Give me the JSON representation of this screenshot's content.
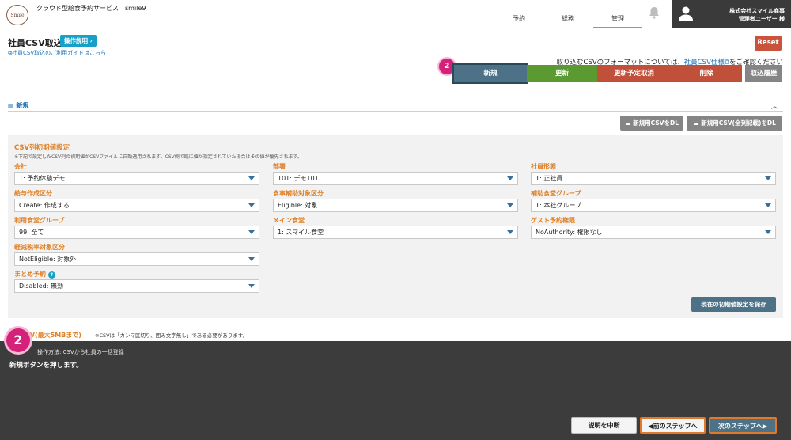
{
  "header": {
    "logo_text": "Smile",
    "service_name": "クラウド型給食予約サービス　smile9",
    "nav": [
      {
        "label": "予約"
      },
      {
        "label": "総務"
      },
      {
        "label": "管理"
      }
    ],
    "company": "株式会社スマイル商事",
    "user": "管理者ユーザー 様"
  },
  "page": {
    "title": "社員CSV取込",
    "help_button": "操作説明 ›",
    "guide_link": "社員CSV取込のご利用ガイドはこちら",
    "reset_button": "Reset",
    "format_note_pre": "取り込むCSVのフォーマットについては、",
    "format_note_link": "社員CSV仕様",
    "format_note_post": "をご確認ください"
  },
  "tabs": [
    {
      "label": "新規"
    },
    {
      "label": "更新"
    },
    {
      "label": "更新予定取消"
    },
    {
      "label": "削除"
    }
  ],
  "history_button": "取込履歴",
  "step_marker_small": "2",
  "section": {
    "title": "新規"
  },
  "download_buttons": [
    "新規用CSVをDL",
    "新規用CSV(全列記載)をDL"
  ],
  "defaults": {
    "title": "CSV列初期値設定",
    "note": "※下記で設定したCSV列の初期値がCSVファイルに自動適用されます。CSV側で既に値が指定されていた場合はその値が優先されます。",
    "fields": {
      "company": {
        "label": "会社",
        "value": "1: 予約体験デモ"
      },
      "dept": {
        "label": "部署",
        "value": "101: デモ101"
      },
      "emptype": {
        "label": "社員形態",
        "value": "1: 正社員"
      },
      "salary": {
        "label": "給与作成区分",
        "value": "Create: 作成する"
      },
      "mealsub": {
        "label": "食事補助対象区分",
        "value": "Eligible: 対象"
      },
      "subgroup": {
        "label": "補助食堂グループ",
        "value": "1: 本社グループ"
      },
      "usegroup": {
        "label": "利用食堂グループ",
        "value": "99: 全て"
      },
      "maincaf": {
        "label": "メイン食堂",
        "value": "1: スマイル食堂"
      },
      "guest": {
        "label": "ゲスト予約権限",
        "value": "NoAuthority: 権限なし"
      },
      "taxred": {
        "label": "軽減税率対象区分",
        "value": "NotEligible: 対象外"
      },
      "bulk": {
        "label": "まとめ予約",
        "value": "Disabled: 無効"
      }
    },
    "save_button": "現在の初期値設定を保存"
  },
  "csv_section": {
    "label": "象CSV(最大5MBまで)",
    "note": "※CSVは「カンマ区切り、囲み文字無し」である必要があります。"
  },
  "overlay": {
    "step_marker": "2",
    "step_title": "操作方法: CSVから社員の一括登録",
    "description": "新規ボタンを押します。",
    "stop_button": "説明を中断",
    "prev_button": "◀前のステップへ",
    "next_button": "次のステップへ▶"
  },
  "colors": {
    "accent_orange": "#e08025",
    "tab_blue": "#4d7287",
    "tab_green": "#5a9a31",
    "tab_red": "#c0503a",
    "marker_pink": "#d4227a"
  }
}
